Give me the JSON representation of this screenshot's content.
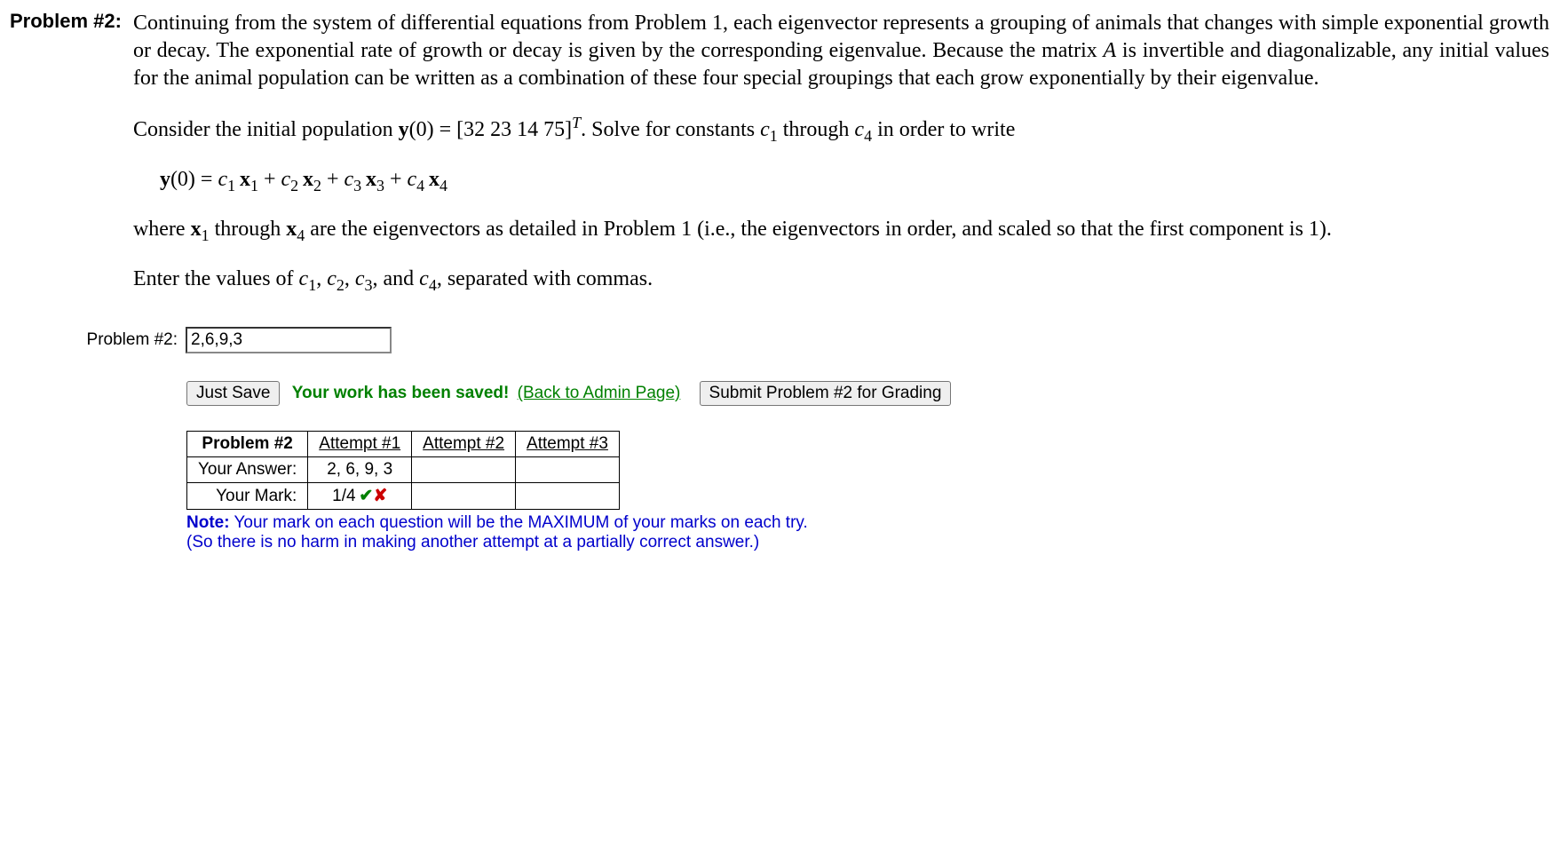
{
  "problem": {
    "label": "Problem #2:",
    "p1_a": "Continuing from the system of differential equations from Problem 1, each eigenvector represents a grouping of animals that changes with simple exponential growth or decay. The exponential rate of growth or decay is given by the corresponding eigenvalue. Because the matrix ",
    "p1_A": "A",
    "p1_b": " is invertible and diagonalizable, any initial values for the animal population can be written as a combination of these four special groupings that each grow exponentially by their eigenvalue.",
    "p2_a": "Consider the initial population ",
    "p2_y0": "y",
    "p2_b": "(0)  =  [32 23 14 75]",
    "p2_T": "T",
    "p2_c": ". Solve for constants ",
    "p2_c1": "c",
    "p2_sub1": "1",
    "p2_d": " through ",
    "p2_c4": "c",
    "p2_sub4": "4",
    "p2_e": " in order to write",
    "eq_y": "y",
    "eq_zero": "(0)   =   ",
    "eq_c1": "c",
    "eq_s1": "1",
    "eq_x1": "x",
    "eq_plus": "  +  ",
    "eq_c2": "c",
    "eq_s2": "2",
    "eq_x2": "x",
    "eq_c3": "c",
    "eq_s3": "3",
    "eq_x3": "x",
    "eq_c4": "c",
    "eq_s4": "4",
    "eq_x4": "x",
    "p3_a": "where ",
    "p3_x1": "x",
    "p3_sub1": "1",
    "p3_b": " through ",
    "p3_x4": "x",
    "p3_sub4": "4",
    "p3_c": " are the eigenvectors as detailed in Problem 1 (i.e., the eigenvectors in order, and scaled so that the first component is 1).",
    "p4_a": "Enter the values of ",
    "p4_c1": "c",
    "p4_s1": "1",
    "p4_sep1": ", ",
    "p4_c2": "c",
    "p4_s2": "2",
    "p4_sep2": ", ",
    "p4_c3": "c",
    "p4_s3": "3",
    "p4_sep3": ", and ",
    "p4_c4": "c",
    "p4_s4": "4",
    "p4_b": ", separated with commas."
  },
  "input": {
    "label": "Problem #2:",
    "value": "2,6,9,3"
  },
  "actions": {
    "just_save": "Just Save",
    "saved_msg": "Your work has been saved!",
    "admin_link": "(Back to Admin Page)",
    "submit": "Submit Problem #2 for Grading"
  },
  "results": {
    "corner": "Problem #2",
    "attempt_cols": [
      "Attempt #1",
      "Attempt #2",
      "Attempt #3"
    ],
    "row_answer_label": "Your Answer:",
    "answers": [
      "2, 6, 9, 3",
      "",
      ""
    ],
    "row_mark_label": "Your Mark:",
    "mark_value": "1/4",
    "mark_check": "✔",
    "mark_cross": "✘"
  },
  "note": {
    "label": "Note:",
    "line1": " Your mark on each question will be the MAXIMUM of your marks on each try.",
    "line2": "(So there is no harm in making another attempt at a partially correct answer.)"
  }
}
